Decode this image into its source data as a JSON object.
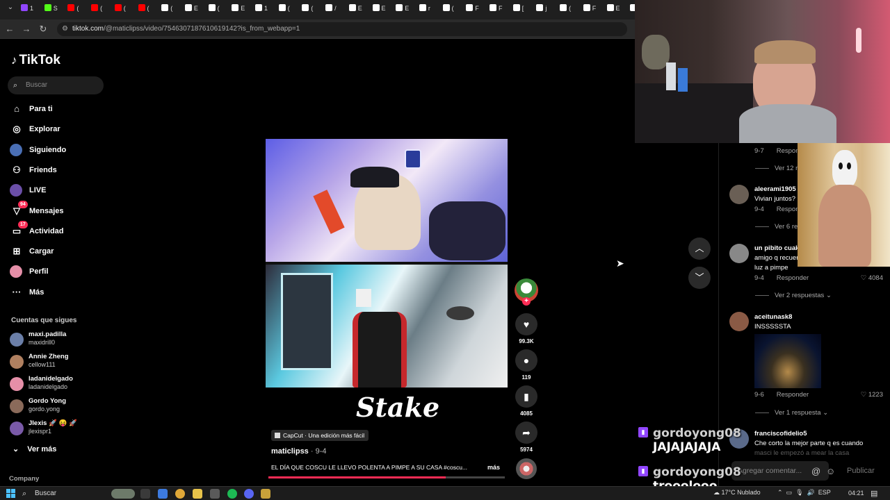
{
  "browser": {
    "url_host": "tiktok.com",
    "url_path": "/@maticlipss/video/7546307187610619142?is_from_webapp=1",
    "tabs": [
      {
        "icon": "twitch-icon",
        "color": "#9146ff",
        "label": "1"
      },
      {
        "icon": "kick-icon",
        "color": "#53fc18",
        "label": "S"
      },
      {
        "icon": "youtube-icon",
        "color": "#ff0000",
        "label": "("
      },
      {
        "icon": "youtube-icon",
        "color": "#ff0000",
        "label": "("
      },
      {
        "icon": "youtube-icon",
        "color": "#ff0000",
        "label": "("
      },
      {
        "icon": "youtube-icon",
        "color": "#ff0000",
        "label": "("
      },
      {
        "icon": "tiktok-icon",
        "color": "#ffffff",
        "label": "("
      },
      {
        "icon": "tiktok-icon",
        "color": "#ffffff",
        "label": "E"
      },
      {
        "icon": "tiktok-icon",
        "color": "#ffffff",
        "label": "("
      },
      {
        "icon": "tiktok-icon",
        "color": "#ffffff",
        "label": "E"
      },
      {
        "icon": "tiktok-icon",
        "color": "#ffffff",
        "label": "1"
      },
      {
        "icon": "tiktok-icon",
        "color": "#ffffff",
        "label": "("
      },
      {
        "icon": "tiktok-icon",
        "color": "#ffffff",
        "label": "("
      },
      {
        "icon": "tiktok-icon",
        "color": "#ffffff",
        "label": "/"
      },
      {
        "icon": "tiktok-icon",
        "color": "#ffffff",
        "label": "E"
      },
      {
        "icon": "tiktok-icon",
        "color": "#ffffff",
        "label": "E"
      },
      {
        "icon": "tiktok-icon",
        "color": "#ffffff",
        "label": "E"
      },
      {
        "icon": "tiktok-icon",
        "color": "#ffffff",
        "label": "r"
      },
      {
        "icon": "tiktok-icon",
        "color": "#ffffff",
        "label": "("
      },
      {
        "icon": "tiktok-icon",
        "color": "#ffffff",
        "label": "F"
      },
      {
        "icon": "tiktok-icon",
        "color": "#ffffff",
        "label": "F"
      },
      {
        "icon": "tiktok-icon",
        "color": "#ffffff",
        "label": "["
      },
      {
        "icon": "tiktok-icon",
        "color": "#ffffff",
        "label": "j"
      },
      {
        "icon": "tiktok-icon",
        "color": "#ffffff",
        "label": "("
      },
      {
        "icon": "tiktok-icon",
        "color": "#ffffff",
        "label": "F"
      },
      {
        "icon": "tiktok-icon",
        "color": "#ffffff",
        "label": "E"
      },
      {
        "icon": "tiktok-icon",
        "color": "#ffffff",
        "label": ""
      }
    ]
  },
  "sidebar": {
    "logo": "TikTok",
    "search_placeholder": "Buscar",
    "nav": [
      {
        "label": "Para ti",
        "icon": "home-icon",
        "glyph": "⌂"
      },
      {
        "label": "Explorar",
        "icon": "compass-icon",
        "glyph": "◎"
      },
      {
        "label": "Siguiendo",
        "icon": "avatar",
        "glyph": ""
      },
      {
        "label": "Friends",
        "icon": "friends-icon",
        "glyph": "⚇"
      },
      {
        "label": "LIVE",
        "icon": "avatar",
        "glyph": ""
      },
      {
        "label": "Mensajes",
        "icon": "message-icon",
        "glyph": "▽",
        "badge": "94"
      },
      {
        "label": "Actividad",
        "icon": "inbox-icon",
        "glyph": "▭",
        "badge": "17"
      },
      {
        "label": "Cargar",
        "icon": "upload-icon",
        "glyph": "⊞"
      },
      {
        "label": "Perfil",
        "icon": "avatar",
        "glyph": ""
      },
      {
        "label": "Más",
        "icon": "more-icon",
        "glyph": "···"
      }
    ],
    "following_title": "Cuentas que sigues",
    "accounts": [
      {
        "name": "maxi.padilla",
        "handle": "maxidrill0",
        "color": "#6b7fa8"
      },
      {
        "name": "Annie Zheng",
        "handle": "cellow111",
        "color": "#b08060"
      },
      {
        "name": "ladanidelgado",
        "handle": "ladanidelgado",
        "color": "#e58fa8"
      },
      {
        "name": "Gordo Yong",
        "handle": "gordo.yong",
        "color": "#8a6a5a"
      },
      {
        "name": "Jlexis 🚀 😝 🚀",
        "handle": "jlexispr1",
        "color": "#7a5aa8"
      }
    ],
    "see_more": "Ver más",
    "company": "Company"
  },
  "video": {
    "overlay_logo": "Stake",
    "capcut": "CapCut · Una edición más fácil",
    "author": "maticlipss",
    "date": "9-4",
    "caption": "EL DÍA QUE COSCU LE LLEVO POLENTA A PIMPE A SU CASA #coscu...",
    "more": "más",
    "progress": 0.75,
    "likes": "99.3K",
    "comments": "119",
    "saves": "4085",
    "shares": "5974"
  },
  "comments": {
    "items": [
      {
        "meta_date": "9-7",
        "reply": "Respon",
        "view": "Ver 12 r"
      },
      {
        "user": "aleerami1905",
        "text": "Vivian juntos?",
        "meta_date": "9-4",
        "reply": "Respon",
        "view": "Ver 6 re",
        "color": "#6a5f55"
      },
      {
        "user": "un pibito cuak",
        "text": "amigo q recuer",
        "text2": "luz a pimpe",
        "meta_date": "9-4",
        "reply": "Responder",
        "likes": "4084",
        "view": "Ver 2 respuestas",
        "color": "#888"
      },
      {
        "user": "aceitunask8",
        "text": "INSSSSSTA",
        "meta_date": "9-6",
        "reply": "Responder",
        "likes": "1223",
        "view": "Ver 1 respuesta",
        "color": "#8a5a45"
      },
      {
        "user": "franciscofidelio5",
        "text": "Che corto la mejor parte q es cuando",
        "text2": "masci le empezó a mear la casa",
        "color": "#5a6a8a"
      }
    ],
    "input_placeholder": "Agregar comentar...",
    "publish": "Publicar"
  },
  "stream_chat": [
    {
      "user": "gordoyong08",
      "message": "JAJAJAJAJA"
    },
    {
      "user": "gordoyong08",
      "message": "trooolooo"
    }
  ],
  "taskbar": {
    "search": "Buscar",
    "weather": "17°C  Nublado",
    "lang": "ESP",
    "time": "04:21"
  }
}
